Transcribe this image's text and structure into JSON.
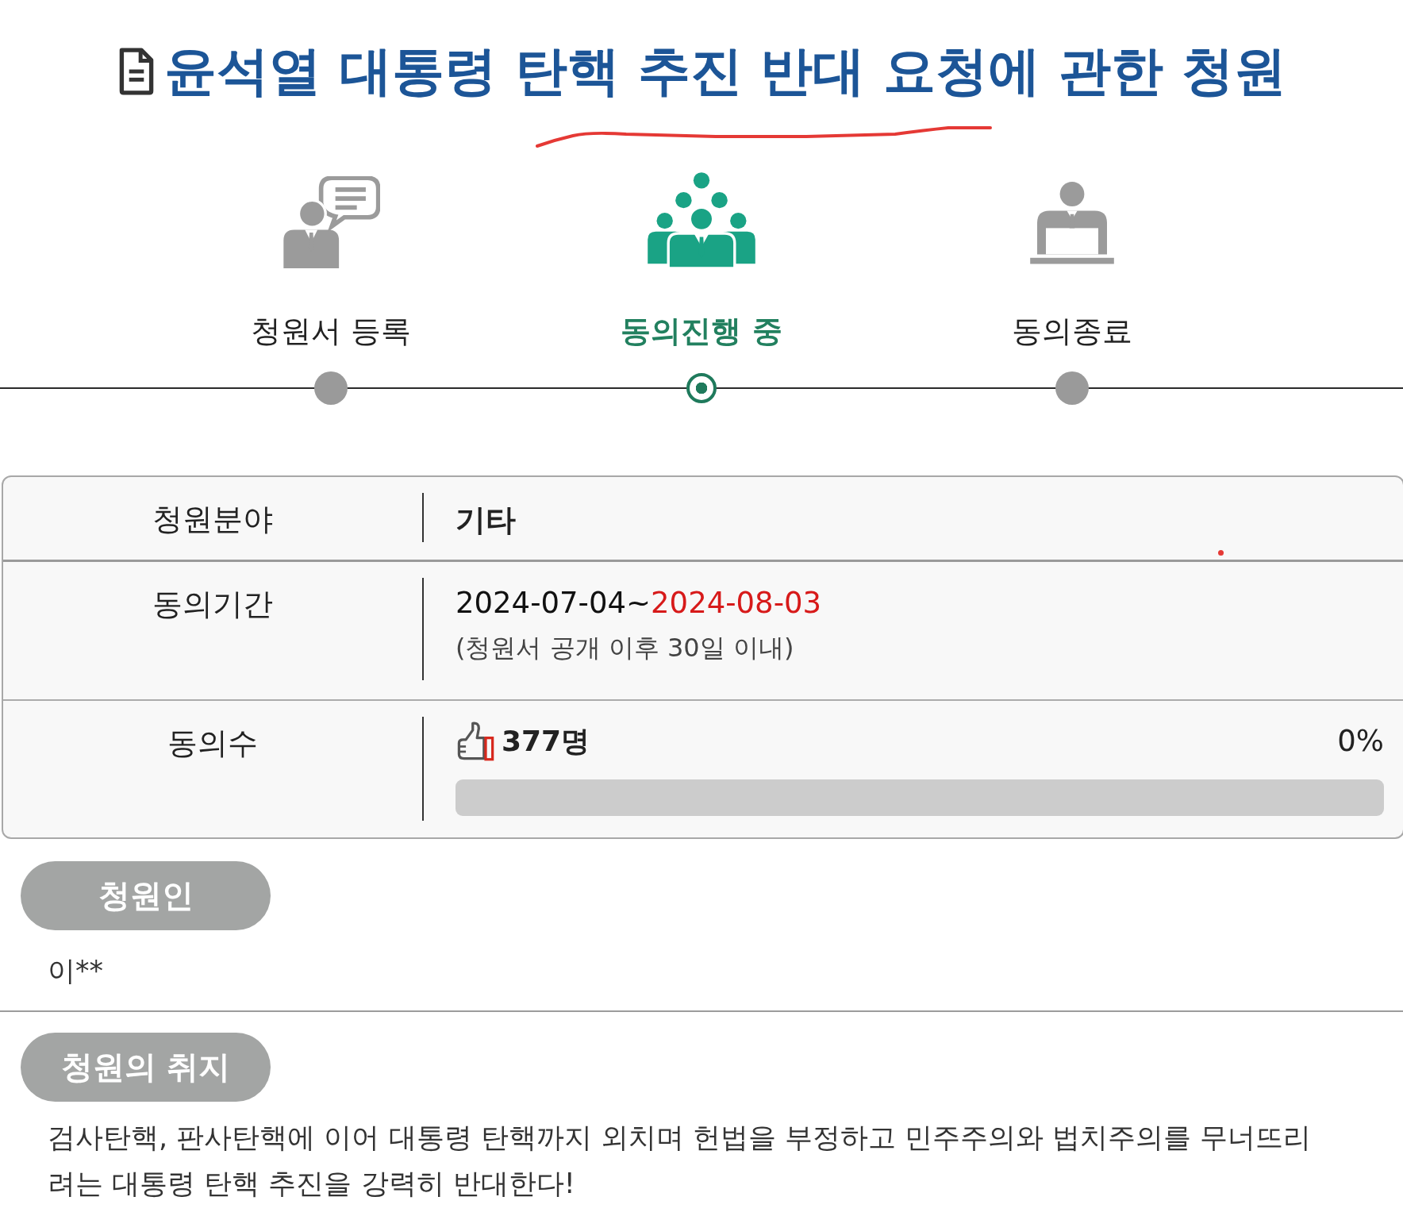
{
  "title": "윤석열 대통령 탄핵 추진 반대 요청에 관한 청원",
  "steps": [
    {
      "kind": "register",
      "label": "청원서 등록",
      "selected": false
    },
    {
      "kind": "agreeing",
      "label": "동의진행 중",
      "selected": true
    },
    {
      "kind": "closed",
      "label": "동의종료",
      "selected": false
    }
  ],
  "info_table": {
    "rows": [
      {
        "kind": "category",
        "label": "청원분야",
        "value": "기타"
      },
      {
        "kind": "period",
        "label": "동의기간",
        "from": "2024-07-04",
        "separator": "~",
        "to": "2024-08-03",
        "note": "(청원서 공개 이후 30일 이내)"
      },
      {
        "kind": "count",
        "label": "동의수",
        "count": "377명",
        "percent": "0%",
        "level": 0
      }
    ]
  },
  "sections": [
    {
      "heading": "청원인",
      "body": "이**"
    },
    {
      "heading": "청원의 취지",
      "body": "검사탄핵, 판사탄핵에 이어 대통령 탄핵까지 외치며 헌법을 부정하고 민주주의와 법치주의를 무너뜨리려는 대통령 탄핵 추진을 강력히 반대한다!"
    }
  ]
}
